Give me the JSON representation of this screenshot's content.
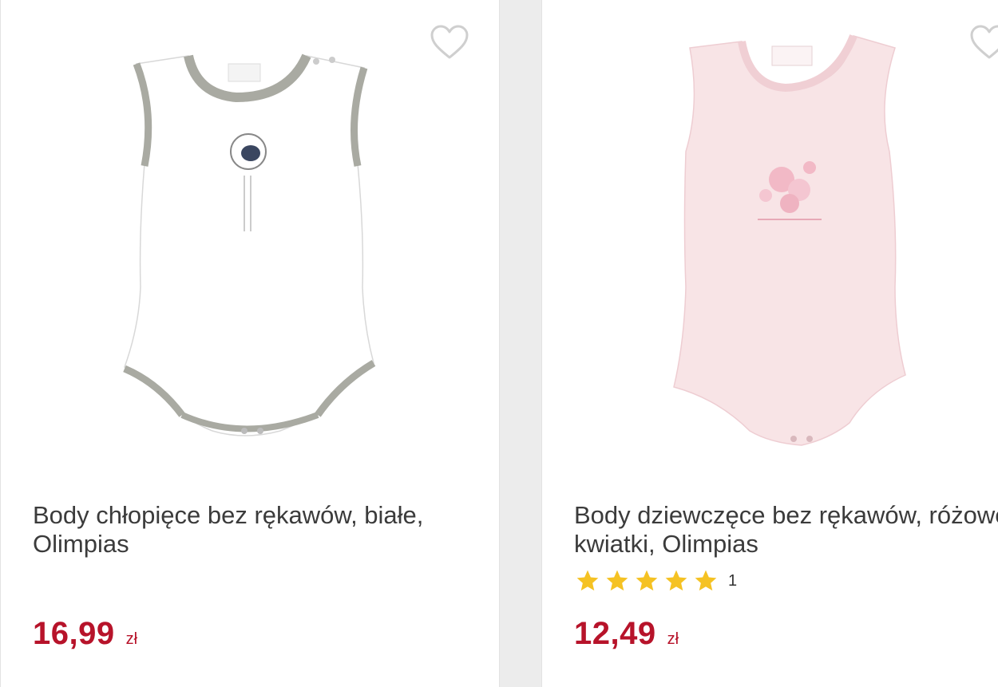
{
  "products": [
    {
      "title": "Body chłopięce bez rękawów, białe, Olimpias",
      "price": "16,99",
      "currency": "zł",
      "image": {
        "color": "#ffffff",
        "trim": "#a9aaa2"
      }
    },
    {
      "title": "Body dziewczęce bez rękawów, różowe, kwiatki, Olimpias",
      "price": "12,49",
      "currency": "zł",
      "rating": {
        "stars": 5,
        "count": "1"
      },
      "image": {
        "color": "#f8e4e6",
        "trim": "#f0cfd4"
      }
    }
  ],
  "icons": {
    "favorite": "heart-outline-icon",
    "rating": "star-icon"
  },
  "colors": {
    "price": "#b7132a",
    "star": "#f5c223",
    "heart": "#cfcfcf"
  }
}
